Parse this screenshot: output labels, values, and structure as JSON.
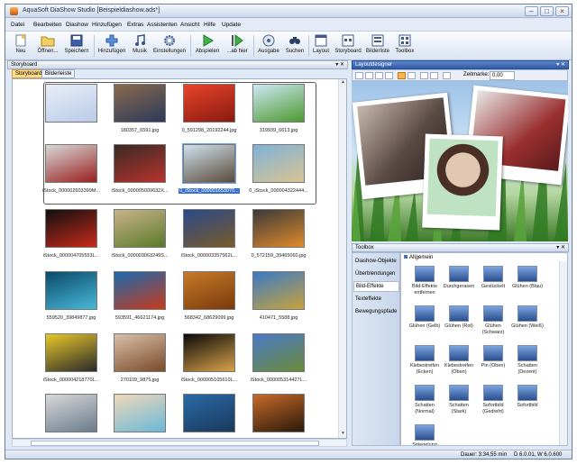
{
  "window": {
    "title": "AquaSoft DiaShow Studio [Beispieldiashow.ads*]",
    "controls": [
      "–",
      "□",
      "×"
    ]
  },
  "menu": [
    "Datei",
    "Bearbeiten",
    "Diashow",
    "Hinzufügen",
    "Extras",
    "Assistenten",
    "Ansicht",
    "Hilfe",
    "Update"
  ],
  "toolbar": [
    {
      "label": "Neu",
      "icon": "new-icon"
    },
    {
      "label": "Öffnen...",
      "icon": "open-icon"
    },
    {
      "label": "Speichern",
      "icon": "save-icon"
    },
    {
      "label": "Hinzufügen",
      "icon": "add-icon"
    },
    {
      "label": "Musik",
      "icon": "music-icon"
    },
    {
      "label": "Einstellungen",
      "icon": "settings-icon"
    },
    {
      "label": "Abspielen",
      "icon": "play-icon"
    },
    {
      "label": "...ab hier",
      "icon": "play-from-here-icon"
    },
    {
      "label": "Ausgabe",
      "icon": "output-icon"
    },
    {
      "label": "Suchen",
      "icon": "search-icon"
    },
    {
      "label": "Layout",
      "icon": "layout-icon"
    },
    {
      "label": "Storyboard",
      "icon": "storyboard-icon"
    },
    {
      "label": "Bilderliste",
      "icon": "image-list-icon"
    },
    {
      "label": "Toolbox",
      "icon": "toolbox-icon"
    }
  ],
  "storyboard": {
    "title": "Storyboard",
    "tabs": [
      "Storyboard",
      "Bilderleiste"
    ],
    "items": [
      {
        "caption": "",
        "colors": [
          "#e8eef8",
          "#b9cbe8"
        ]
      },
      {
        "caption": "180357_6591.jpg",
        "colors": [
          "#8a6a4e",
          "#2c3a5a"
        ]
      },
      {
        "caption": "0_591298_20192244.jpg",
        "colors": [
          "#e8442a",
          "#8a1a12"
        ]
      },
      {
        "caption": "319939_6613.jpg",
        "colors": [
          "#cfe7f5",
          "#4a9a2e"
        ]
      },
      {
        "caption": "iStock_000002603399M...",
        "colors": [
          "#d8d8d8",
          "#9a2020"
        ]
      },
      {
        "caption": "iStock_000005009632X...",
        "colors": [
          "#3a2a24",
          "#b8332e"
        ]
      },
      {
        "caption": "0_iStock_000001653070...",
        "colors": [
          "#cfe1ec",
          "#5a4a3a"
        ]
      },
      {
        "caption": "0_iStock_000004322444...",
        "colors": [
          "#7fb2da",
          "#d8c390"
        ]
      },
      {
        "caption": "iStock_000004705553L...",
        "colors": [
          "#101010",
          "#c92a1a"
        ]
      },
      {
        "caption": "iStock_000003063249S...",
        "colors": [
          "#c9b28a",
          "#5a7a2a"
        ]
      },
      {
        "caption": "iStock_000003357562L...",
        "colors": [
          "#2a4a8a",
          "#7a5a2a"
        ]
      },
      {
        "caption": "0_572159_39465060.jpg",
        "colors": [
          "#3a3a3a",
          "#e08a2a"
        ]
      },
      {
        "caption": "559520_39849877.jpg",
        "colors": [
          "#0a4a6a",
          "#4ab8d8"
        ]
      },
      {
        "caption": "593591_46621174.jpg",
        "colors": [
          "#1a6ab0",
          "#c83a1a"
        ]
      },
      {
        "caption": "568342_68629099.jpg",
        "colors": [
          "#c87a2a",
          "#7a3a0a"
        ]
      },
      {
        "caption": "410471_5588.jpg",
        "colors": [
          "#3a7ac8",
          "#c8a23a"
        ]
      },
      {
        "caption": "iStock_000004218770L...",
        "colors": [
          "#e8c82a",
          "#2a2a2a"
        ]
      },
      {
        "caption": "270109_9875.jpg",
        "colors": [
          "#d8c0a8",
          "#7a4a2a"
        ]
      },
      {
        "caption": "iStock_000005105610L...",
        "colors": [
          "#0a0a0a",
          "#d8a24a"
        ]
      },
      {
        "caption": "iStock_000005314427L...",
        "colors": [
          "#4a7ac8",
          "#6a8a3a"
        ]
      },
      {
        "caption": "",
        "colors": [
          "#d8d8d8",
          "#6a7a8a"
        ]
      },
      {
        "caption": "",
        "colors": [
          "#f0d8b8",
          "#6ab8d8"
        ]
      },
      {
        "caption": "",
        "colors": [
          "#2a6aa8",
          "#1a3a5a"
        ]
      },
      {
        "caption": "",
        "colors": [
          "#c86a2a",
          "#2a1a0a"
        ]
      }
    ],
    "selected_index": 6
  },
  "layoutdesigner": {
    "title": "Layoutdesigner",
    "zeitmarke_label": "Zeitmarke:",
    "zeitmarke_value": "0,00"
  },
  "toolbox": {
    "title": "Toolbox",
    "categories": [
      "Diashow-Objekte",
      "Überblendungen",
      "Bild-Effekte",
      "Texteffekte",
      "Bewegungspfade"
    ],
    "active_category": 2,
    "group_label": "Allgemein",
    "effects": [
      "Bild-Effekte\nentfernen",
      "Durchgerasen",
      "Gestückelt",
      "Glühen (Blau)",
      "Glühen (Gelb)",
      "Glühen (Rot)",
      "Glühen\n(Schwarz)",
      "Glühen (Weiß)",
      "Klebestreifen\n(Ecken)",
      "Klebestreifen\n(Oben)",
      "Pin (Oben)",
      "Schatten\n(Dezent)",
      "Schatten\n(Normal)",
      "Schatten\n(Stark)",
      "Sofortbild\n(Gedreht)",
      "Sofortbild",
      "Spiegelung"
    ]
  },
  "status": {
    "duration": "Dauer: 3:34,55 min",
    "dimensions": "D 6.0.01, W 6.0.600"
  },
  "colors": {
    "accent": "#2f5ba8",
    "selection": "#3a6fd0",
    "tab_active": "#ffd98a"
  }
}
